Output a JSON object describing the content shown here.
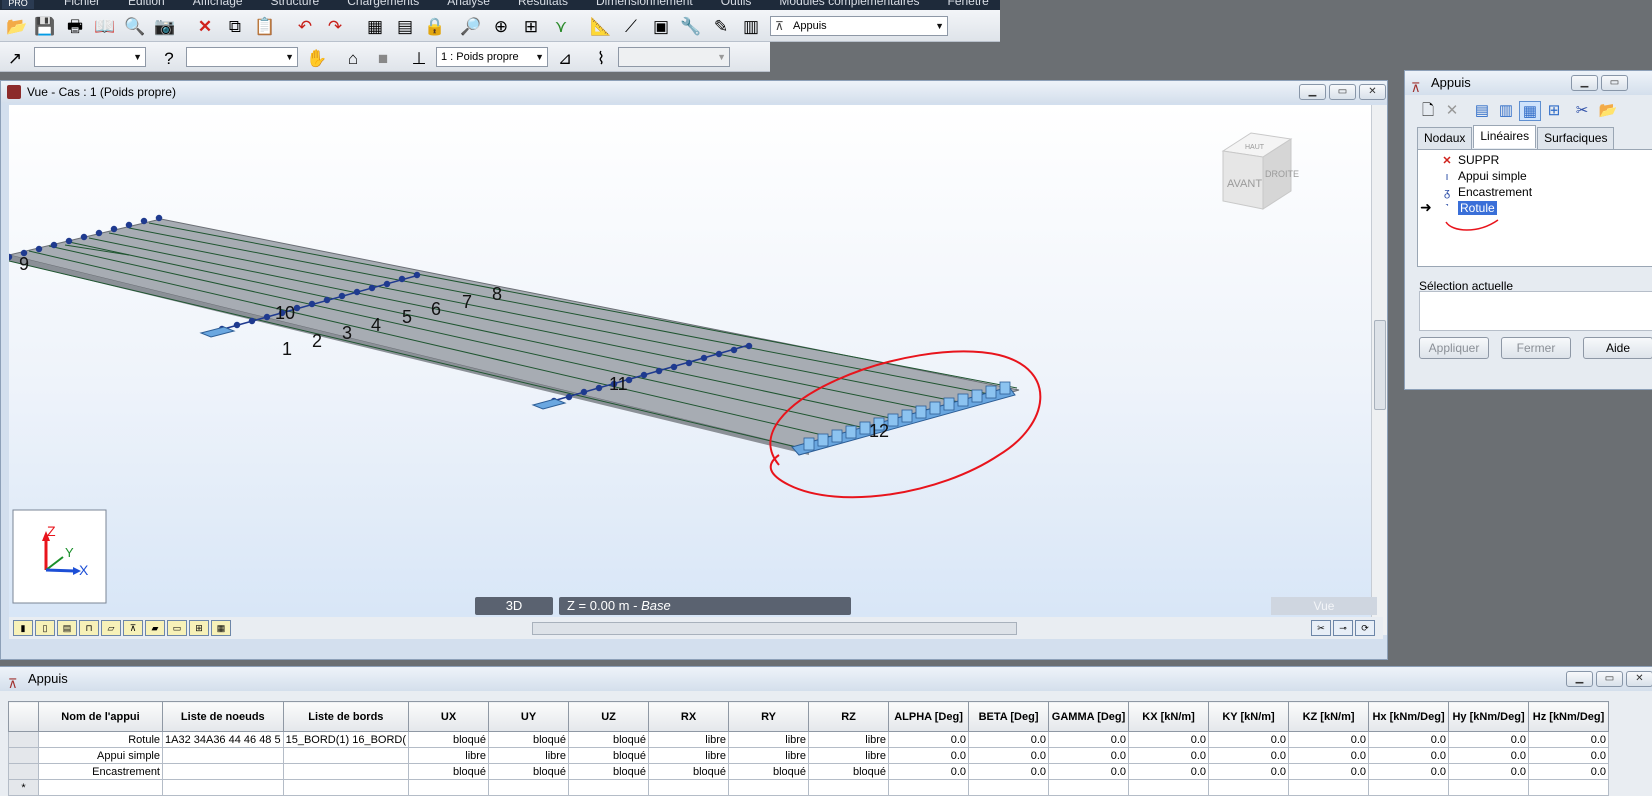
{
  "menu": [
    "Fichier",
    "Edition",
    "Affichage",
    "Structure",
    "Chargements",
    "Analyse",
    "Résultats",
    "Dimensionnement",
    "Outils",
    "Modules complémentaires",
    "Fenêtre",
    "?"
  ],
  "app_logo": "PRO",
  "toolbar1": {
    "combo_value": "Appuis"
  },
  "toolbar2": {
    "load_case": "1 : Poids propre"
  },
  "view": {
    "title": "Vue - Cas : 1 (Poids propre)",
    "cube_front": "AVANT",
    "cube_right": "DROITE",
    "cube_top": "HAUT",
    "labels": [
      "1",
      "2",
      "3",
      "4",
      "5",
      "6",
      "7",
      "8",
      "9",
      "10",
      "11",
      "12"
    ],
    "mode_3d": "3D",
    "z_text": "Z = 0.00 m - ",
    "z_level": "Base",
    "vue_label": "Vue",
    "axis": {
      "z": "Z",
      "y": "Y",
      "x": "X"
    }
  },
  "dialog": {
    "title": "Appuis",
    "tabs": [
      "Nodaux",
      "Linéaires",
      "Surfaciques"
    ],
    "active_tab": "Linéaires",
    "items": [
      {
        "label": "SUPPR",
        "icon": "red-x-icon"
      },
      {
        "label": "Appui simple",
        "icon": "simple-support-icon"
      },
      {
        "label": "Encastrement",
        "icon": "fixed-support-icon"
      },
      {
        "label": "Rotule",
        "icon": "hinge-icon",
        "selected": true
      }
    ],
    "selection_label": "Sélection actuelle",
    "buttons": [
      "Appliquer",
      "Fermer",
      "Aide"
    ]
  },
  "table_window": {
    "title": "Appuis",
    "columns": [
      "Nom de l'appui",
      "Liste de noeuds",
      "Liste de bords",
      "UX",
      "UY",
      "UZ",
      "RX",
      "RY",
      "RZ",
      "ALPHA [Deg]",
      "BETA [Deg]",
      "GAMMA [Deg]",
      "KX [kN/m]",
      "KY [kN/m]",
      "KZ [kN/m]",
      "Hx [kNm/Deg]",
      "Hy [kNm/Deg]",
      "Hz [kNm/Deg]"
    ],
    "rows": [
      [
        "Rotule",
        "1A32 34A36 44 46 48 5",
        "15_BORD(1) 16_BORD(",
        "bloqué",
        "bloqué",
        "bloqué",
        "libre",
        "libre",
        "libre",
        "0.0",
        "0.0",
        "0.0",
        "0.0",
        "0.0",
        "0.0",
        "0.0",
        "0.0",
        "0.0"
      ],
      [
        "Appui simple",
        "",
        "",
        "libre",
        "libre",
        "bloqué",
        "libre",
        "libre",
        "libre",
        "0.0",
        "0.0",
        "0.0",
        "0.0",
        "0.0",
        "0.0",
        "0.0",
        "0.0",
        "0.0"
      ],
      [
        "Encastrement",
        "",
        "",
        "bloqué",
        "bloqué",
        "bloqué",
        "bloqué",
        "bloqué",
        "bloqué",
        "0.0",
        "0.0",
        "0.0",
        "0.0",
        "0.0",
        "0.0",
        "0.0",
        "0.0",
        "0.0"
      ]
    ],
    "new_row_marker": "*"
  },
  "colors": {
    "annotation": "#e8141c",
    "deck": "#a7acb3",
    "support": "#6aa7e0"
  }
}
